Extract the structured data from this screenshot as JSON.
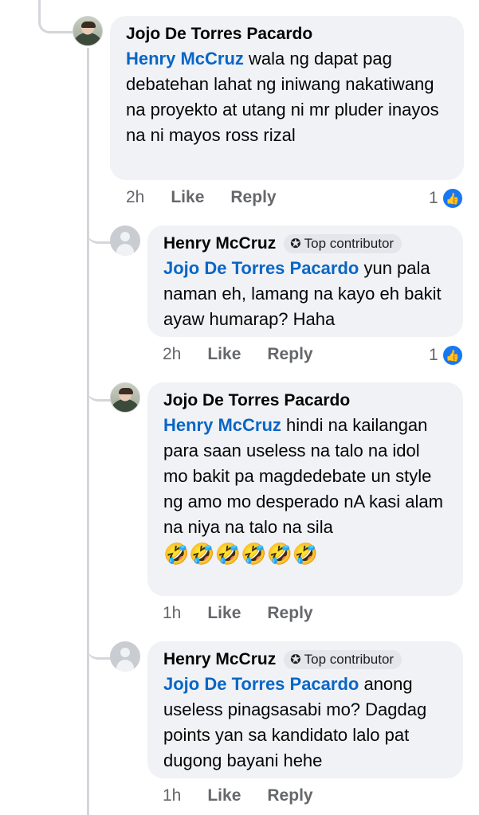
{
  "comments": [
    {
      "author": "Jojo De Torres Pacardo",
      "mention": "Henry McCruz",
      "body": " wala ng dapat pag debatehan lahat ng iniwang nakatiwang na proyekto at utang ni mr pluder inayos na ni mayos ross rizal",
      "time": "2h",
      "like_label": "Like",
      "reply_label": "Reply",
      "reactions": "1"
    },
    {
      "author": "Henry McCruz",
      "badge": "Top contributor",
      "mention": "Jojo De Torres Pacardo",
      "body": " yun pala naman eh, lamang na kayo eh bakit ayaw humarap? Haha",
      "time": "2h",
      "like_label": "Like",
      "reply_label": "Reply",
      "reactions": "1"
    },
    {
      "author": "Jojo De Torres Pacardo",
      "mention": "Henry McCruz",
      "body": " hindi na kailangan para saan useless  na talo na idol mo bakit pa magdedebate un style ng amo mo desperado nA  kasi alam na niya na talo na sila ",
      "emojis": "🤣🤣🤣🤣🤣🤣",
      "time": "1h",
      "like_label": "Like",
      "reply_label": "Reply"
    },
    {
      "author": "Henry McCruz",
      "badge": "Top contributor",
      "mention": "Jojo De Torres Pacardo",
      "body": " anong useless pinagsasabi mo? Dagdag points yan sa kandidato lalo pat dugong bayani hehe",
      "time": "1h",
      "like_label": "Like",
      "reply_label": "Reply"
    }
  ],
  "icons": {
    "badge": "top-contributor-icon",
    "reaction": "like-reaction-icon"
  },
  "colors": {
    "mention": "#0866c6",
    "bubble": "#f0f2f5",
    "like_blue": "#1877f2"
  }
}
